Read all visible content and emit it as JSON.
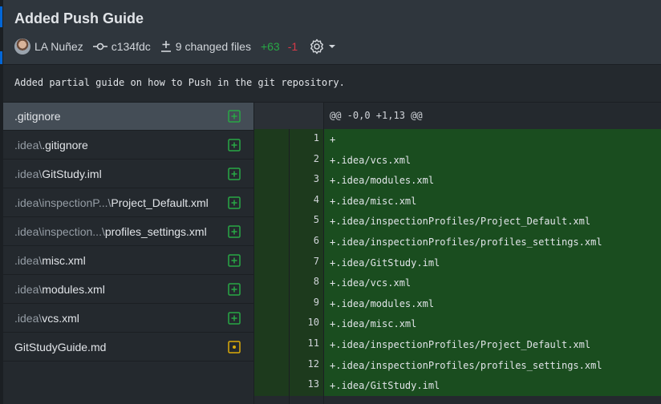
{
  "commit": {
    "title": "Added Push Guide",
    "author": "LA Nuñez",
    "sha": "c134fdc",
    "changed_files": "9 changed files",
    "additions": "+63",
    "deletions": "-1",
    "message": "Added partial guide on how to Push in the git repository."
  },
  "files": [
    {
      "prefix": "",
      "name": ".gitignore",
      "status": "added",
      "selected": true
    },
    {
      "prefix": ".idea\\",
      "name": ".gitignore",
      "status": "added"
    },
    {
      "prefix": ".idea\\",
      "name": "GitStudy.iml",
      "status": "added"
    },
    {
      "prefix": ".idea\\inspectionP...\\",
      "name": "Project_Default.xml",
      "status": "added"
    },
    {
      "prefix": ".idea\\inspection...\\",
      "name": "profiles_settings.xml",
      "status": "added"
    },
    {
      "prefix": ".idea\\",
      "name": "misc.xml",
      "status": "added"
    },
    {
      "prefix": ".idea\\",
      "name": "modules.xml",
      "status": "added"
    },
    {
      "prefix": ".idea\\",
      "name": "vcs.xml",
      "status": "added"
    },
    {
      "prefix": "",
      "name": "GitStudyGuide.md",
      "status": "modified"
    }
  ],
  "diff": {
    "hunk_header": "@@ -0,0 +1,13 @@",
    "lines": [
      {
        "num": "1",
        "text": "+"
      },
      {
        "num": "2",
        "text": "+.idea/vcs.xml"
      },
      {
        "num": "3",
        "text": "+.idea/modules.xml"
      },
      {
        "num": "4",
        "text": "+.idea/misc.xml"
      },
      {
        "num": "5",
        "text": "+.idea/inspectionProfiles/Project_Default.xml"
      },
      {
        "num": "6",
        "text": "+.idea/inspectionProfiles/profiles_settings.xml"
      },
      {
        "num": "7",
        "text": "+.idea/GitStudy.iml"
      },
      {
        "num": "8",
        "text": "+.idea/vcs.xml"
      },
      {
        "num": "9",
        "text": "+.idea/modules.xml"
      },
      {
        "num": "10",
        "text": "+.idea/misc.xml"
      },
      {
        "num": "11",
        "text": "+.idea/inspectionProfiles/Project_Default.xml"
      },
      {
        "num": "12",
        "text": "+.idea/inspectionProfiles/profiles_settings.xml"
      },
      {
        "num": "13",
        "text": "+.idea/GitStudy.iml"
      }
    ]
  },
  "colors": {
    "added_icon": "#28a745",
    "modified_icon": "#dbab09",
    "addition_text": "#28a745",
    "deletion_text": "#d73a49"
  }
}
